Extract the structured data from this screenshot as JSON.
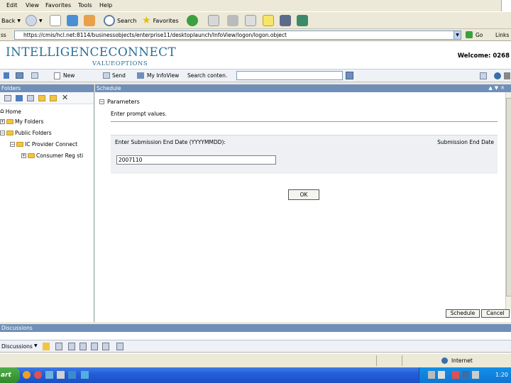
{
  "menubar": {
    "items": [
      "Edit",
      "View",
      "Favorites",
      "Tools",
      "Help"
    ]
  },
  "toolbar": {
    "back": "Back",
    "search": "Search",
    "favorites": "Favorites"
  },
  "address": {
    "label": "ss",
    "url": "https://cmis/hcl.net:8114/businessobjects/enterprise11/desktoplaunch/InfoView/logon/logon.object",
    "go": "Go",
    "links": "Links"
  },
  "banner": {
    "logo_main": "INTELLIGENCECONNECT",
    "logo_sub": "VALUEOPTIONS",
    "welcome": "Welcome: 0268"
  },
  "apptb": {
    "new": "New",
    "send": "Send",
    "infoview": "My InfoView",
    "search_label": "Search conten."
  },
  "folders": {
    "header": "Folders",
    "items": [
      "Home",
      "My Folders",
      "Public Folders",
      "IC Provider Connect",
      "Consumer Reg sti"
    ]
  },
  "schedule": {
    "header": "Schedule",
    "section": "Parameters",
    "prompt": "Enter prompt values.",
    "field_label": "Enter Submission End Date (YYYYMMDD):",
    "field_right": "Submission End Date",
    "field_value": "2007110",
    "ok": "OK",
    "schedule_btn": "Schedule",
    "cancel_btn": "Cancel"
  },
  "discussions": {
    "header": "Discussions",
    "tb_label": "Discussions"
  },
  "status": {
    "zone": "Internet"
  },
  "taskbar": {
    "start": "art",
    "clock": "1:20"
  }
}
